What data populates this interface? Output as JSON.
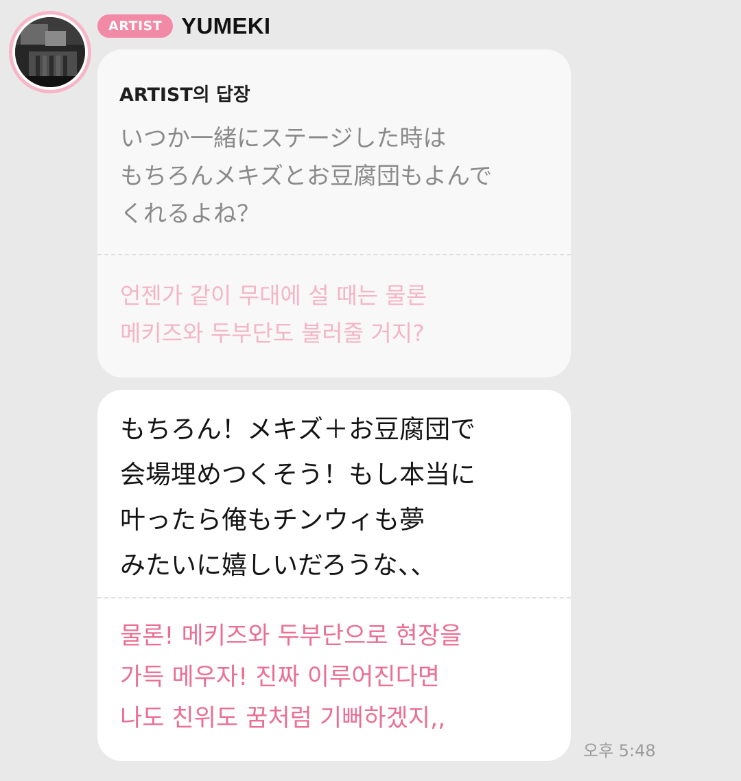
{
  "sender": {
    "badge": "ARTIST",
    "name": "YUMEKI"
  },
  "reply_card": {
    "heading": "ARTIST의 답장",
    "japanese": "いつか一緒にステージした時は\nもちろんメキズとお豆腐団もよんで\nくれるよね？",
    "korean": "언젠가 같이 무대에 설 때는 물론\n메키즈와 두부단도 불러줄 거지?"
  },
  "message": {
    "japanese": "もちろん！メキズ＋お豆腐団で\n会場埋めつくそう！もし本当に\n叶ったら俺もチンウィも夢\nみたいに嬉しいだろうな、、",
    "korean": "물론! 메키즈와 두부단으로 현장을\n가득 메우자! 진짜 이루어진다면\n나도 친위도 꿈처럼 기뻐하겠지,,"
  },
  "timestamp": "오후 5:48",
  "colors": {
    "background": "#e9e9e9",
    "badge": "#f28aa6",
    "avatar_ring": "#f7b6c8",
    "translation_pink": "#ea6f92",
    "reply_translation_pink": "#f4b5c6",
    "reply_text_gray": "#8a8a8a"
  }
}
